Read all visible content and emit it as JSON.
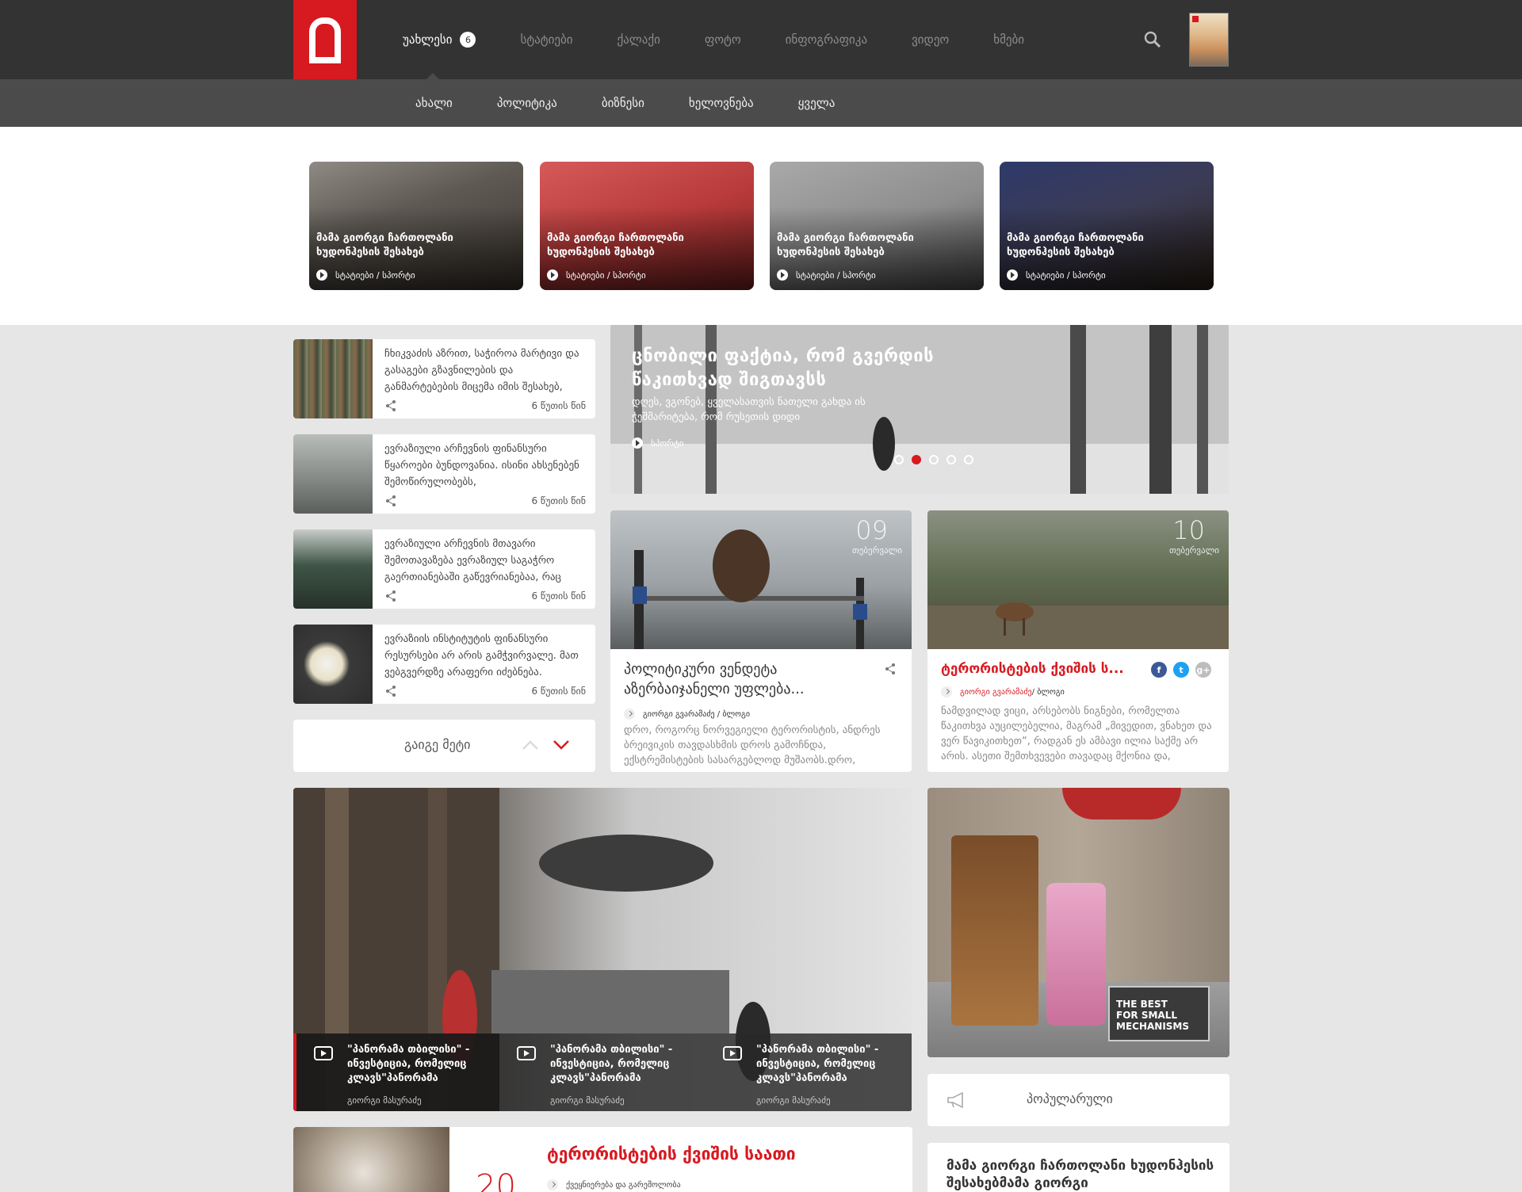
{
  "header": {
    "nav": [
      {
        "label": "უახლესი",
        "badge": "6",
        "active": true
      },
      {
        "label": "სტატიები"
      },
      {
        "label": "ქალაქი"
      },
      {
        "label": "ფოტო"
      },
      {
        "label": "ინფოგრაფიკა"
      },
      {
        "label": "ვიდეო"
      },
      {
        "label": "ხმები"
      }
    ],
    "search_icon": "search-icon",
    "accent": "#d71920"
  },
  "subnav": [
    {
      "label": "ახალი"
    },
    {
      "label": "პოლიტიკა"
    },
    {
      "label": "ბიზნესი"
    },
    {
      "label": "ხელოვნება"
    },
    {
      "label": "ყველა"
    }
  ],
  "featured": [
    {
      "title": "მამა გიორგი ჩართოლანი ხუდონჰესის შესახებ",
      "meta": "სტატიები / სპორტი"
    },
    {
      "title": "მამა გიორგი ჩართოლანი ხუდონჰესის შესახებ",
      "meta": "სტატიები / სპორტი"
    },
    {
      "title": "მამა გიორგი ჩართოლანი ხუდონჰესის შესახებ",
      "meta": "სტატიები / სპორტი"
    },
    {
      "title": "მამა გიორგი ჩართოლანი ხუდონჰესის შესახებ",
      "meta": "სტატიები / სპორტი"
    }
  ],
  "list": [
    {
      "text": "ჩხიკვაძის აზრით, საჭიროა მარტივი და გასაგები გზავნილების და განმარტებების მიცემა იმის შესახებ,",
      "time": "6 წუთის წინ"
    },
    {
      "text": "ევრაზიული არჩევნის ფინანსური წყაროები ბუნდოვანია. ისინი ახსენებენ შემოწირულობებს,",
      "time": "6 წუთის წინ"
    },
    {
      "text": "ევრაზიული არჩევნის მთავარი შემოთავაზება ევრაზიულ საგაჭრო გაერთიანებაში გაწევრიანებაა, რაც",
      "time": "6 წუთის წინ"
    },
    {
      "text": "ევრაზიის ინსტიტუტის ფინანსური რესურსები არ არის გამჭვირვალე. მათ ვებგვერდზე არაფერი იძებნება.",
      "time": "6 წუთის წინ"
    }
  ],
  "more": {
    "label": "გაიგე მეტი"
  },
  "hero": {
    "title": "ცნობილი ფაქტია, რომ გვერდის წაკითხვად შიგთავსს",
    "subtitle": "დღეს, ვგონებ, ყველასათვის ნათელი გახდა ის ჭეშმარიტება, რომ რუსეთის დიდი",
    "meta": "სპორტი",
    "slide_count": 5,
    "active_slide": 2
  },
  "cards": [
    {
      "day": "09",
      "month": "თებერვალი",
      "title": "პოლიტიკური ვენდეტა აზერბაიჯანელი უფლება...",
      "byline": "გიორგი გვარამაძე / ბლოგი",
      "excerpt": "დრო,  როგორც ნორვეგიელი ტერორისტის, ანდრეს ბრეივიკის თავდასხმის დროს გამოჩნდა, ექსტრემისტების სასარგებლოდ მუშაობს.დრო,"
    },
    {
      "day": "10",
      "month": "თებერვალი",
      "title": "ტერორისტების ქვიშის ს...",
      "author": "გიორგი გვარამაძე",
      "byline_rest": " / ბლოგი",
      "excerpt": "ნამდვილად ვიცი, არსებობს ნიგნები, რომელთა წაკითხვა აუცილებელია, მაგრამ „მივედით, ვნახეთ და ვერ წავიკითხეთ“, რადგან ეს ამბავი ილია საქმე არ არის. ასეთი შემთხვევები თავადაც მქონია და,"
    }
  ],
  "videos": [
    {
      "title": "\"პანორამა თბილისი\" - ინვესტიცია, რომელიც კლავს\"პანორამა",
      "author": "გიორგი მასურაძე"
    },
    {
      "title": "\"პანორამა თბილისი\" - ინვესტიცია, რომელიც კლავს\"პანორამა",
      "author": "გიორგი მასურაძე"
    },
    {
      "title": "\"პანორამა თბილისი\" - ინვესტიცია, რომელიც კლავს\"პანორამა",
      "author": "გიორგი მასურაძე"
    }
  ],
  "ad": {
    "line1": "THE BEST",
    "line2": "FOR SMALL",
    "line3": "MECHANISMS"
  },
  "popular": {
    "label": "პოპულარული",
    "first_title": "მამა გიორგი ჩართოლანი ხუდონჰესის შესახებმამა გიორგი"
  },
  "bottom_article": {
    "number": "20",
    "title": "ტერორისტების ქვიშის საათი",
    "byline": "ქვეყნიერება და გარემოლობა"
  }
}
